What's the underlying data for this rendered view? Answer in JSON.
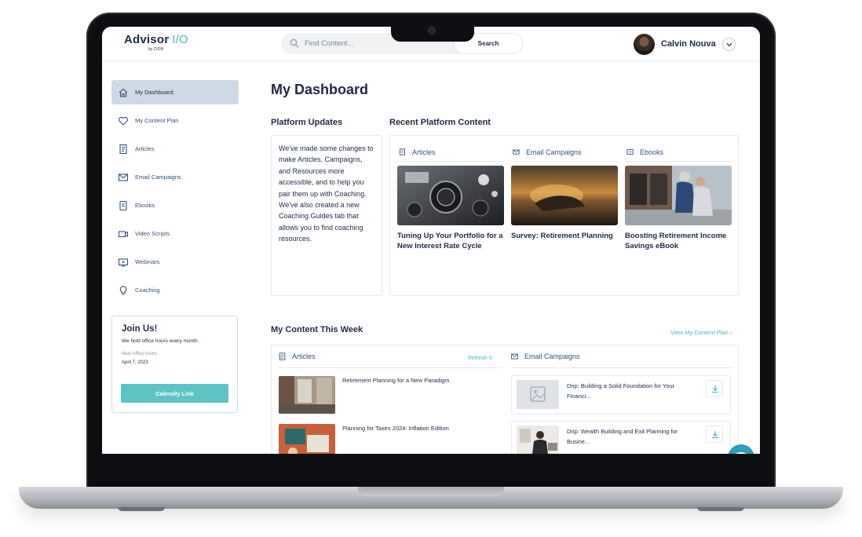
{
  "header": {
    "logo_text": "Advisor",
    "logo_io": "I/O",
    "logo_sub": "by CION",
    "search_placeholder": "Find Content...",
    "search_button": "Search",
    "user_name": "Calvin Nouva"
  },
  "sidebar": {
    "items": [
      {
        "label": "My Dashboard",
        "icon": "home-icon",
        "active": true
      },
      {
        "label": "My Content Plan",
        "icon": "heart-icon"
      },
      {
        "label": "Articles",
        "icon": "document-icon"
      },
      {
        "label": "Email Campaigns",
        "icon": "envelope-icon"
      },
      {
        "label": "Ebooks",
        "icon": "ebook-icon"
      },
      {
        "label": "Video Scripts",
        "icon": "video-icon"
      },
      {
        "label": "Webinars",
        "icon": "monitor-icon"
      },
      {
        "label": "Coaching",
        "icon": "lightbulb-icon"
      }
    ],
    "join": {
      "title": "Join Us!",
      "text": "We hold office hours every month.",
      "next_label": "Next office hours:",
      "date": "April 7, 2023",
      "button": "Calendly Link"
    }
  },
  "main": {
    "title": "My Dashboard",
    "platform_updates": {
      "title": "Platform Updates",
      "text": "We've made some changes to make Articles, Campaigns, and Resources more accessible, and to help you pair them up with Coaching. We've also created a new Coaching Guides tab that allows you to find coaching resources."
    },
    "recent": {
      "title": "Recent Platform Content",
      "columns": [
        {
          "category": "Articles",
          "icon": "document-icon",
          "title": "Tuning Up Your Portfolio for a New Interest Rate Cycle"
        },
        {
          "category": "Email Campaigns",
          "icon": "envelope-icon",
          "title": "Survey: Retirement Planning"
        },
        {
          "category": "Ebooks",
          "icon": "ebook-icon",
          "title": "Boosting Retirement Income Savings eBook"
        }
      ]
    },
    "week": {
      "title": "My Content This Week",
      "view_plan": "View My Content Plan ›",
      "articles_label": "Articles",
      "refresh": "Refresh ↻",
      "emails_label": "Email Campaigns",
      "articles": [
        {
          "title": "Retirement Planning for a New Paradigm"
        },
        {
          "title": "Planning for Taxes 2024: Inflation Edition"
        }
      ],
      "emails": [
        {
          "title": "Drip: Building a Solid Foundation for Your Financi..."
        },
        {
          "title": "Drip: Wealth Building and Exit Planning for Busine..."
        }
      ]
    }
  },
  "colors": {
    "accent": "#4cb8c4",
    "navy": "#1d2a44",
    "active_nav": "#cfd9e6",
    "button": "#5ec3c4"
  }
}
